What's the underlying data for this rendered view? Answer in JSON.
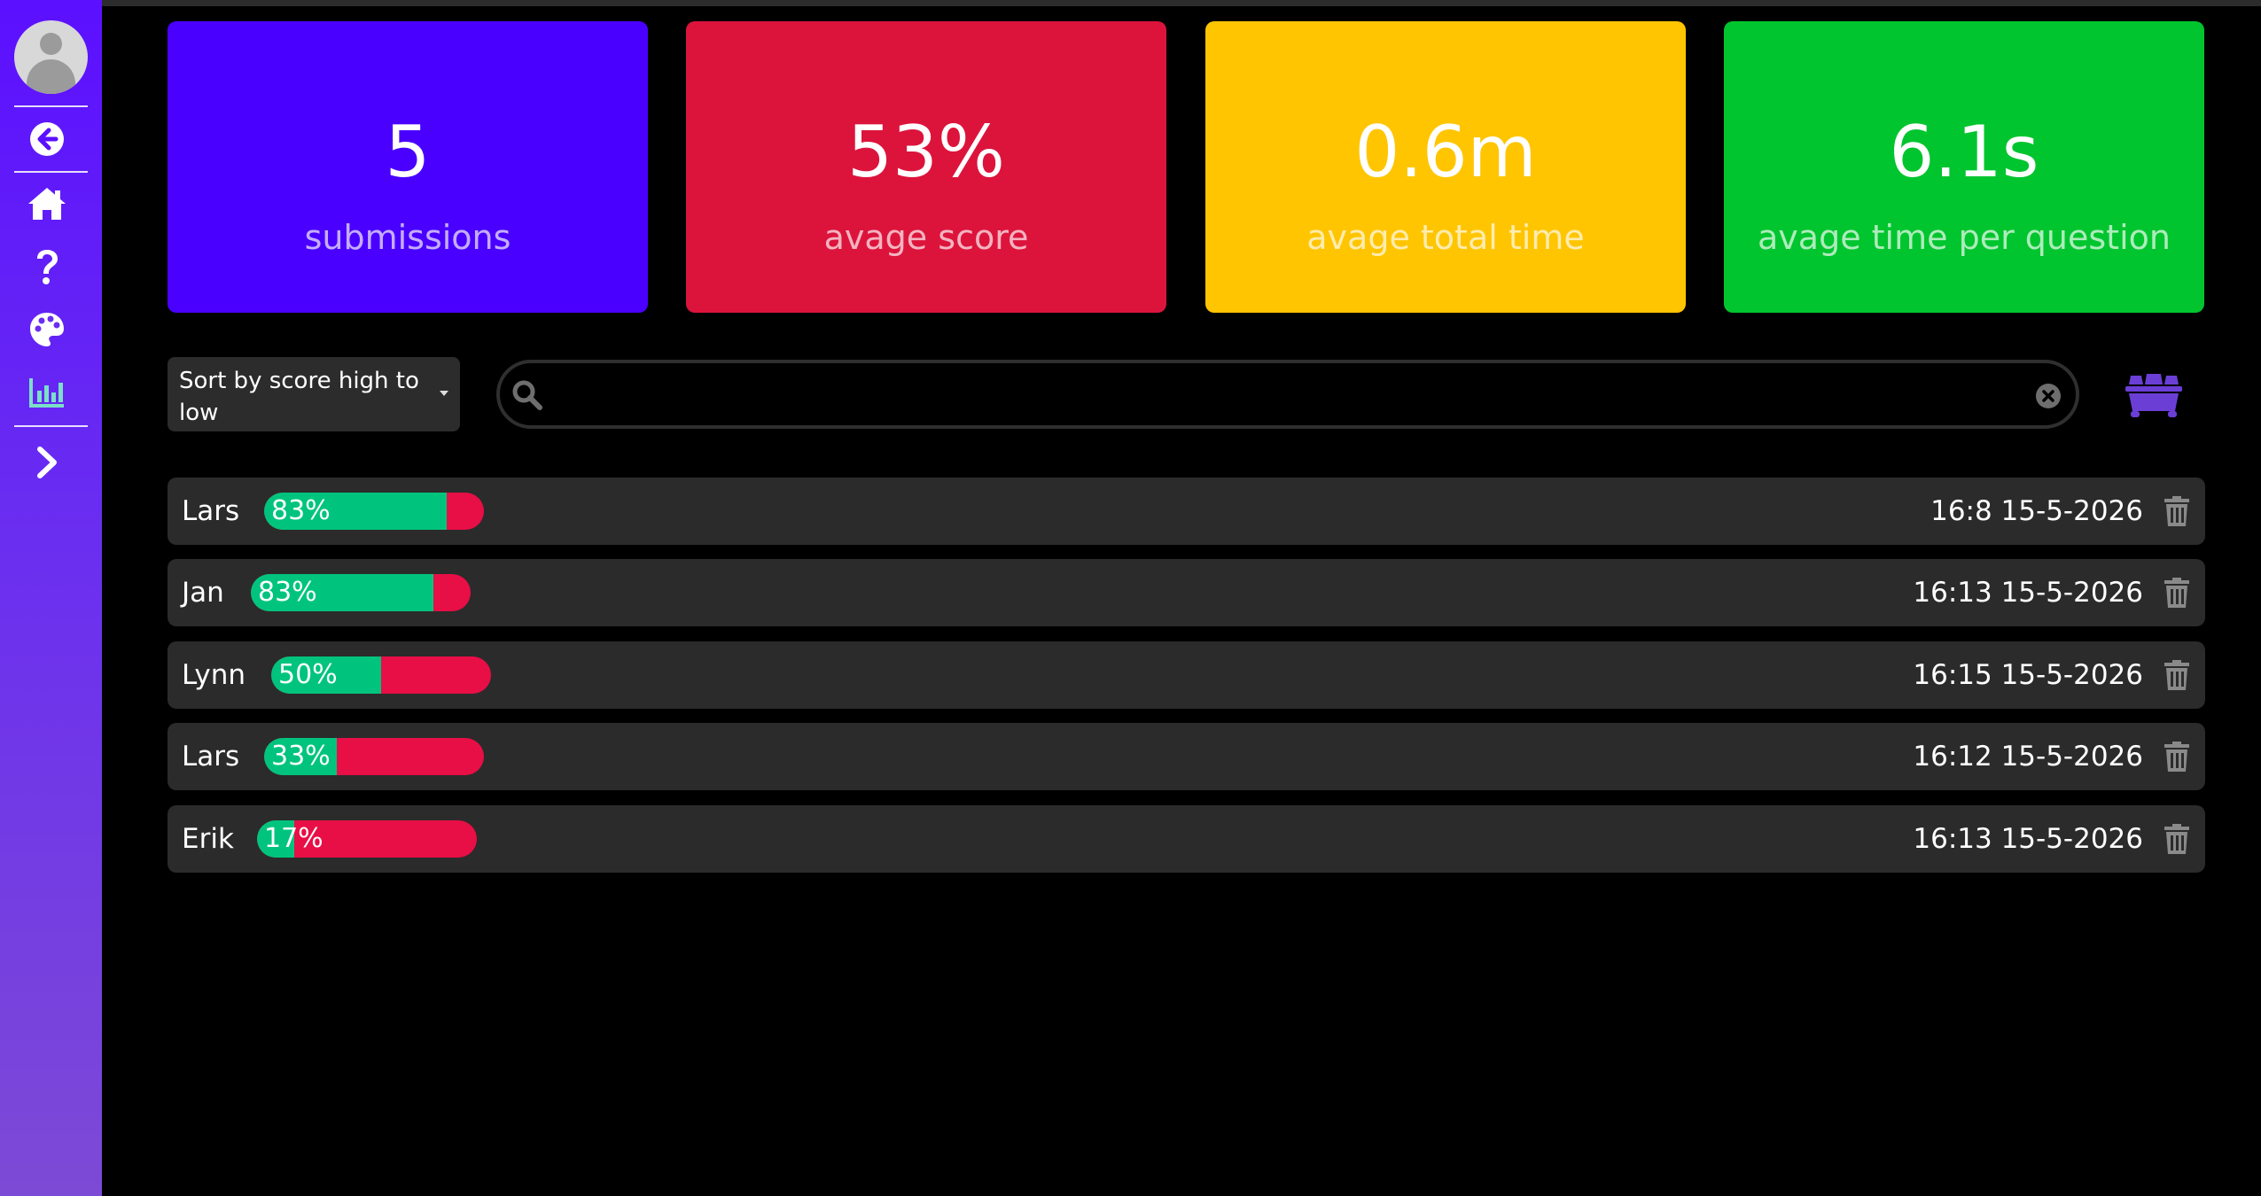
{
  "sidebar": {
    "items": [
      {
        "icon": "arrow-circle-left-icon"
      },
      {
        "icon": "home-icon"
      },
      {
        "icon": "question-icon"
      },
      {
        "icon": "palette-icon"
      },
      {
        "icon": "chart-bar-icon"
      },
      {
        "icon": "chevron-right-icon"
      }
    ],
    "active_color": "#7be0c8"
  },
  "stats": [
    {
      "value": "5",
      "label": "submissions",
      "color": "#4a00ff"
    },
    {
      "value": "53%",
      "label": "avage score",
      "color": "#dc143c"
    },
    {
      "value": "0.6m",
      "label": "avage total time",
      "color": "#ffc500"
    },
    {
      "value": "6.1s",
      "label": "avage time per question",
      "color": "#00c52e"
    }
  ],
  "controls": {
    "sort_label": "Sort by score high to low",
    "search_value": "",
    "search_placeholder": ""
  },
  "colors": {
    "correct": "#00c47d",
    "wrong": "#e80e46",
    "row_bg": "#2b2b2b",
    "accent_bin": "#6b3fd6"
  },
  "submissions": [
    {
      "name": "Lars",
      "score_label": "83%",
      "score": 0.83,
      "time": "16:8 15-5-2026"
    },
    {
      "name": "Jan",
      "score_label": "83%",
      "score": 0.83,
      "time": "16:13 15-5-2026"
    },
    {
      "name": "Lynn",
      "score_label": "50%",
      "score": 0.5,
      "time": "16:15 15-5-2026"
    },
    {
      "name": "Lars",
      "score_label": "33%",
      "score": 0.33,
      "time": "16:12 15-5-2026"
    },
    {
      "name": "Erik",
      "score_label": "17%",
      "score": 0.17,
      "time": "16:13 15-5-2026"
    }
  ]
}
